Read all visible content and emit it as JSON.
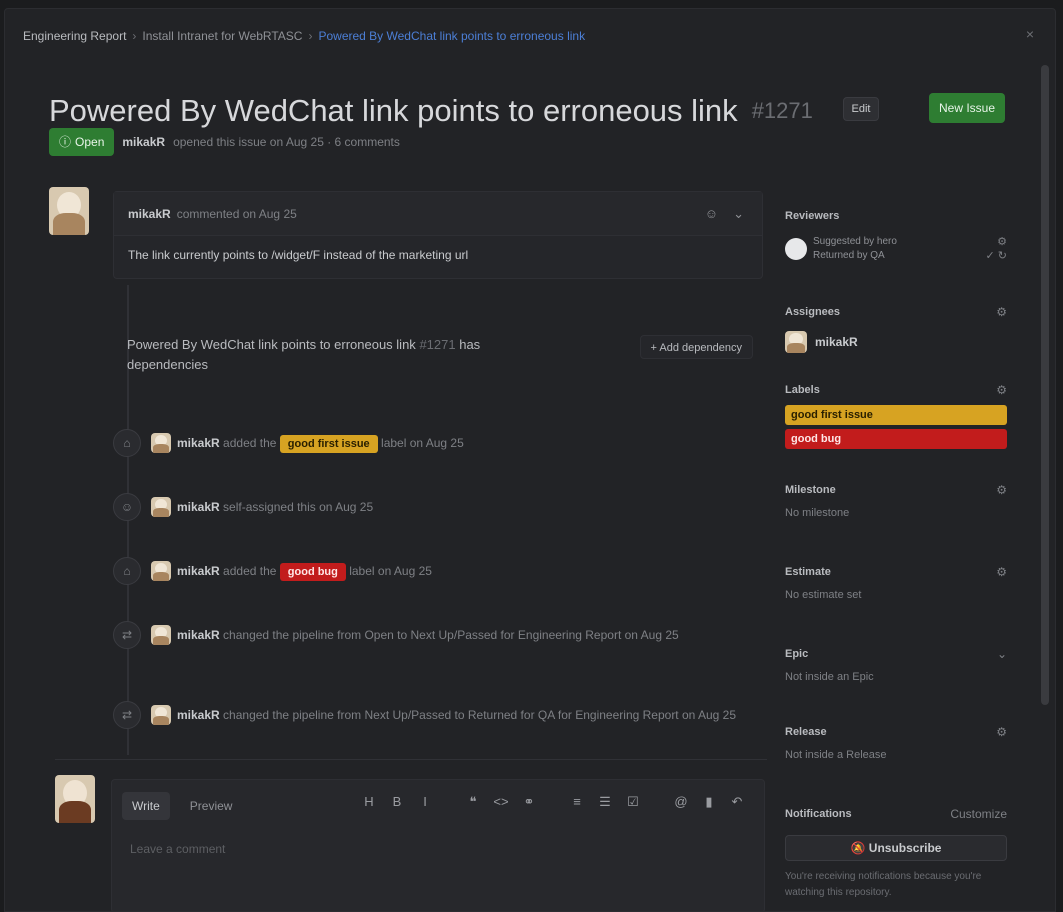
{
  "breadcrumb": {
    "team": "Engineering Report",
    "project": "Install Intranet for WebRTASC",
    "current": "Powered By WedChat link points to erroneous link"
  },
  "issue": {
    "title": "Powered By WedChat link points to erroneous link",
    "number": "#1271",
    "state": "Open",
    "author": "mikakR",
    "opened_text": "opened this issue on Aug 25 · 6 comments",
    "edit_label": "Edit",
    "new_issue_label": "New Issue"
  },
  "comment": {
    "author": "mikakR",
    "when": "commented on Aug 25",
    "body": "The link currently points to /widget/F instead of the marketing url"
  },
  "dependency": {
    "title": "Powered By WedChat link points to erroneous link",
    "number": "#1271",
    "suffix": "has dependencies",
    "add_label": "Add dependency"
  },
  "events": [
    {
      "user": "mikakR",
      "before": "added the",
      "label": "good first issue",
      "label_color": "#d7a322",
      "after": "label on Aug 25"
    },
    {
      "user": "mikakR",
      "before": "self-assigned this on Aug 25",
      "label": "",
      "label_color": "",
      "after": ""
    },
    {
      "user": "mikakR",
      "before": "added the",
      "label": "good bug",
      "label_color": "#c21c1c",
      "after": "label on Aug 25"
    },
    {
      "user": "mikakR",
      "before": "changed the pipeline from Open to Next Up/Passed for Engineering Report on Aug 25",
      "label": "",
      "label_color": "",
      "after": ""
    },
    {
      "user": "mikakR",
      "before": "changed the pipeline from Next Up/Passed to Returned for QA for Engineering Report on Aug 25",
      "label": "",
      "label_color": "",
      "after": ""
    }
  ],
  "editor": {
    "tab_write": "Write",
    "tab_preview": "Preview",
    "placeholder": "Leave a comment"
  },
  "sidebar": {
    "reviewers": {
      "heading": "Reviewers",
      "line1": "Suggested by hero",
      "line2": "Returned by QA"
    },
    "assignees": {
      "heading": "Assignees",
      "name": "mikakR"
    },
    "labels": {
      "heading": "Labels",
      "items": [
        {
          "name": "good first issue",
          "color": "#d7a322"
        },
        {
          "name": "good bug",
          "color": "#c21c1c"
        }
      ]
    },
    "milestone": {
      "heading": "Milestone",
      "value": "No milestone"
    },
    "estimate": {
      "heading": "Estimate",
      "value": "No estimate set"
    },
    "epic": {
      "heading": "Epic",
      "value": "Not inside an Epic"
    },
    "release": {
      "heading": "Release",
      "value": "Not inside a Release"
    },
    "notifications": {
      "heading": "Notifications",
      "customize": "Customize",
      "button": "Unsubscribe",
      "hint": "You're receiving notifications because you're watching this repository."
    }
  }
}
